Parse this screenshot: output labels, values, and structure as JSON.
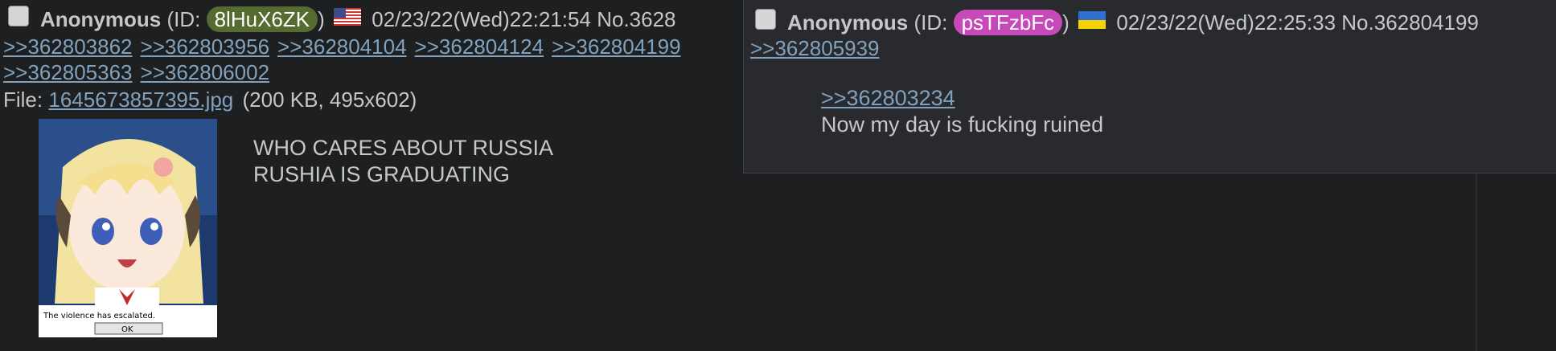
{
  "post": {
    "name": "Anonymous",
    "id_prefix": "(ID:",
    "id_value": "8lHuX6ZK",
    "id_suffix": ")",
    "id_color": "#556b2f",
    "flag": "United States flag",
    "datetime": "02/23/22(Wed)22:21:54",
    "number": "No.3628",
    "backlinks": [
      ">>362803862",
      ">>362803956",
      ">>362804104",
      ">>362804124",
      ">>362804199",
      ">>362805363",
      ">>362806002"
    ],
    "file_label": "File:",
    "file_name": "1645673857395.jpg",
    "file_meta": "(200 KB, 495x602)",
    "thumb_caption": "The violence has escalated.",
    "thumb_button": "OK",
    "comment_lines": [
      "WHO CARES ABOUT RUSSIA",
      "RUSHIA IS GRADUATING"
    ]
  },
  "hover_post": {
    "name": "Anonymous",
    "id_prefix": "(ID:",
    "id_value": "psTFzbFc",
    "id_suffix": ")",
    "id_color": "#c549b8",
    "flag": "Ukraine flag",
    "datetime": "02/23/22(Wed)22:25:33",
    "number": "No.362804199",
    "backlink": ">>362805939",
    "quote_link": ">>362803234",
    "comment": "Now my day is fucking ruined"
  }
}
